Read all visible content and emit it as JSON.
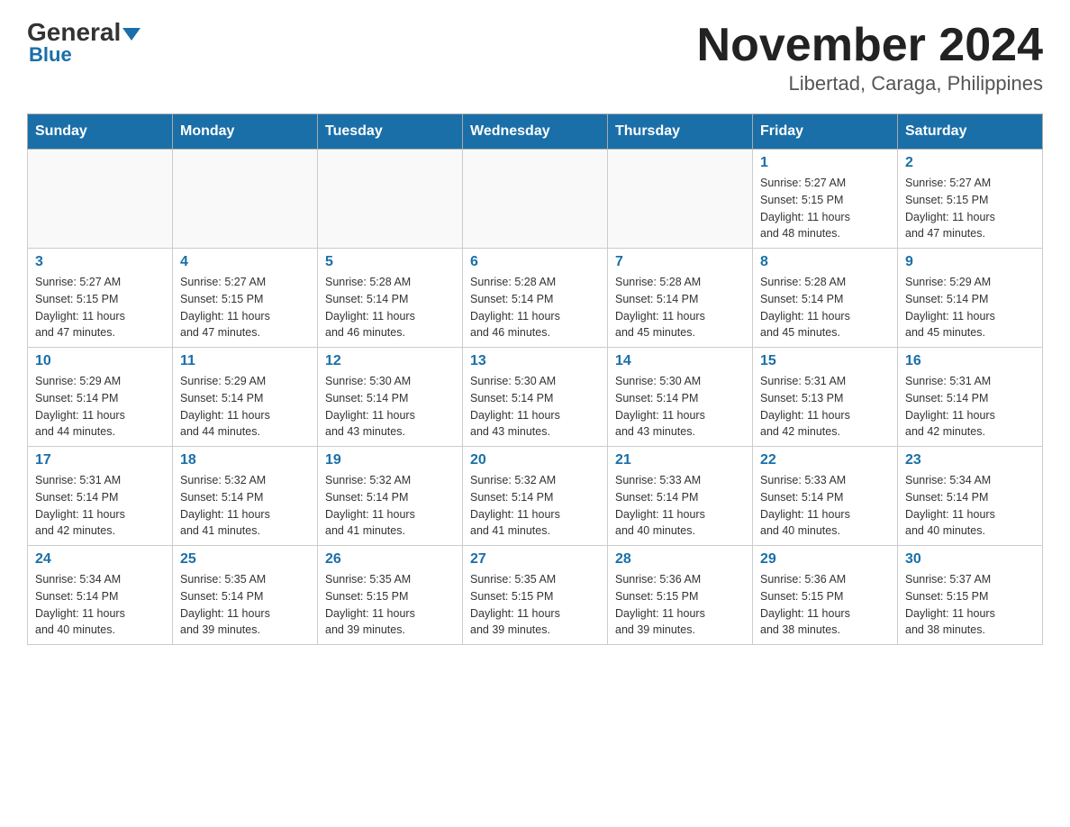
{
  "logo": {
    "general": "General",
    "blue": "Blue"
  },
  "title": "November 2024",
  "subtitle": "Libertad, Caraga, Philippines",
  "days_of_week": [
    "Sunday",
    "Monday",
    "Tuesday",
    "Wednesday",
    "Thursday",
    "Friday",
    "Saturday"
  ],
  "weeks": [
    [
      {
        "day": "",
        "info": ""
      },
      {
        "day": "",
        "info": ""
      },
      {
        "day": "",
        "info": ""
      },
      {
        "day": "",
        "info": ""
      },
      {
        "day": "",
        "info": ""
      },
      {
        "day": "1",
        "info": "Sunrise: 5:27 AM\nSunset: 5:15 PM\nDaylight: 11 hours\nand 48 minutes."
      },
      {
        "day": "2",
        "info": "Sunrise: 5:27 AM\nSunset: 5:15 PM\nDaylight: 11 hours\nand 47 minutes."
      }
    ],
    [
      {
        "day": "3",
        "info": "Sunrise: 5:27 AM\nSunset: 5:15 PM\nDaylight: 11 hours\nand 47 minutes."
      },
      {
        "day": "4",
        "info": "Sunrise: 5:27 AM\nSunset: 5:15 PM\nDaylight: 11 hours\nand 47 minutes."
      },
      {
        "day": "5",
        "info": "Sunrise: 5:28 AM\nSunset: 5:14 PM\nDaylight: 11 hours\nand 46 minutes."
      },
      {
        "day": "6",
        "info": "Sunrise: 5:28 AM\nSunset: 5:14 PM\nDaylight: 11 hours\nand 46 minutes."
      },
      {
        "day": "7",
        "info": "Sunrise: 5:28 AM\nSunset: 5:14 PM\nDaylight: 11 hours\nand 45 minutes."
      },
      {
        "day": "8",
        "info": "Sunrise: 5:28 AM\nSunset: 5:14 PM\nDaylight: 11 hours\nand 45 minutes."
      },
      {
        "day": "9",
        "info": "Sunrise: 5:29 AM\nSunset: 5:14 PM\nDaylight: 11 hours\nand 45 minutes."
      }
    ],
    [
      {
        "day": "10",
        "info": "Sunrise: 5:29 AM\nSunset: 5:14 PM\nDaylight: 11 hours\nand 44 minutes."
      },
      {
        "day": "11",
        "info": "Sunrise: 5:29 AM\nSunset: 5:14 PM\nDaylight: 11 hours\nand 44 minutes."
      },
      {
        "day": "12",
        "info": "Sunrise: 5:30 AM\nSunset: 5:14 PM\nDaylight: 11 hours\nand 43 minutes."
      },
      {
        "day": "13",
        "info": "Sunrise: 5:30 AM\nSunset: 5:14 PM\nDaylight: 11 hours\nand 43 minutes."
      },
      {
        "day": "14",
        "info": "Sunrise: 5:30 AM\nSunset: 5:14 PM\nDaylight: 11 hours\nand 43 minutes."
      },
      {
        "day": "15",
        "info": "Sunrise: 5:31 AM\nSunset: 5:13 PM\nDaylight: 11 hours\nand 42 minutes."
      },
      {
        "day": "16",
        "info": "Sunrise: 5:31 AM\nSunset: 5:14 PM\nDaylight: 11 hours\nand 42 minutes."
      }
    ],
    [
      {
        "day": "17",
        "info": "Sunrise: 5:31 AM\nSunset: 5:14 PM\nDaylight: 11 hours\nand 42 minutes."
      },
      {
        "day": "18",
        "info": "Sunrise: 5:32 AM\nSunset: 5:14 PM\nDaylight: 11 hours\nand 41 minutes."
      },
      {
        "day": "19",
        "info": "Sunrise: 5:32 AM\nSunset: 5:14 PM\nDaylight: 11 hours\nand 41 minutes."
      },
      {
        "day": "20",
        "info": "Sunrise: 5:32 AM\nSunset: 5:14 PM\nDaylight: 11 hours\nand 41 minutes."
      },
      {
        "day": "21",
        "info": "Sunrise: 5:33 AM\nSunset: 5:14 PM\nDaylight: 11 hours\nand 40 minutes."
      },
      {
        "day": "22",
        "info": "Sunrise: 5:33 AM\nSunset: 5:14 PM\nDaylight: 11 hours\nand 40 minutes."
      },
      {
        "day": "23",
        "info": "Sunrise: 5:34 AM\nSunset: 5:14 PM\nDaylight: 11 hours\nand 40 minutes."
      }
    ],
    [
      {
        "day": "24",
        "info": "Sunrise: 5:34 AM\nSunset: 5:14 PM\nDaylight: 11 hours\nand 40 minutes."
      },
      {
        "day": "25",
        "info": "Sunrise: 5:35 AM\nSunset: 5:14 PM\nDaylight: 11 hours\nand 39 minutes."
      },
      {
        "day": "26",
        "info": "Sunrise: 5:35 AM\nSunset: 5:15 PM\nDaylight: 11 hours\nand 39 minutes."
      },
      {
        "day": "27",
        "info": "Sunrise: 5:35 AM\nSunset: 5:15 PM\nDaylight: 11 hours\nand 39 minutes."
      },
      {
        "day": "28",
        "info": "Sunrise: 5:36 AM\nSunset: 5:15 PM\nDaylight: 11 hours\nand 39 minutes."
      },
      {
        "day": "29",
        "info": "Sunrise: 5:36 AM\nSunset: 5:15 PM\nDaylight: 11 hours\nand 38 minutes."
      },
      {
        "day": "30",
        "info": "Sunrise: 5:37 AM\nSunset: 5:15 PM\nDaylight: 11 hours\nand 38 minutes."
      }
    ]
  ]
}
